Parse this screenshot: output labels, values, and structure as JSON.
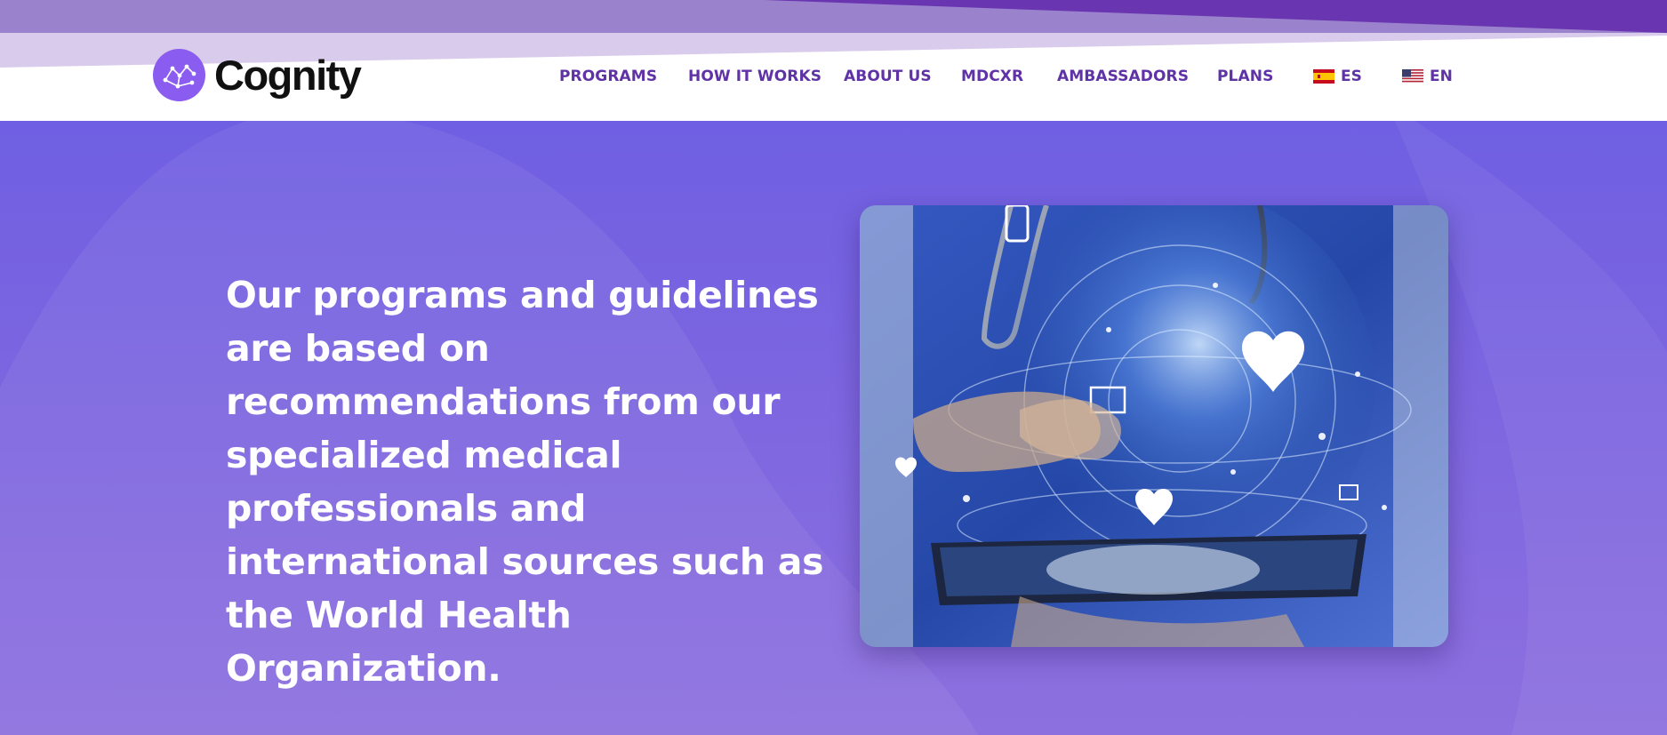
{
  "brand": {
    "name": "Cognity",
    "logo_icon": "constellation-icon",
    "accent_color": "#8a5cf0",
    "nav_color": "#5f32a6"
  },
  "nav": {
    "items": [
      {
        "label": "PROGRAMS"
      },
      {
        "label": "HOW IT WORKS"
      },
      {
        "label": "ABOUT US"
      },
      {
        "label": "MDCXR"
      },
      {
        "label": "AMBASSADORS"
      },
      {
        "label": "PLANS"
      }
    ],
    "languages": [
      {
        "code": "ES",
        "flag": "spain-flag-icon"
      },
      {
        "code": "EN",
        "flag": "usa-flag-icon"
      }
    ]
  },
  "hero": {
    "text": "Our programs and guidelines are based on recommendations from our specialized medical professionals and international sources such as the World Health Organization.",
    "image": "doctor-holding-tablet-with-medical-hologram-image",
    "background_color": "#7d66e0"
  }
}
